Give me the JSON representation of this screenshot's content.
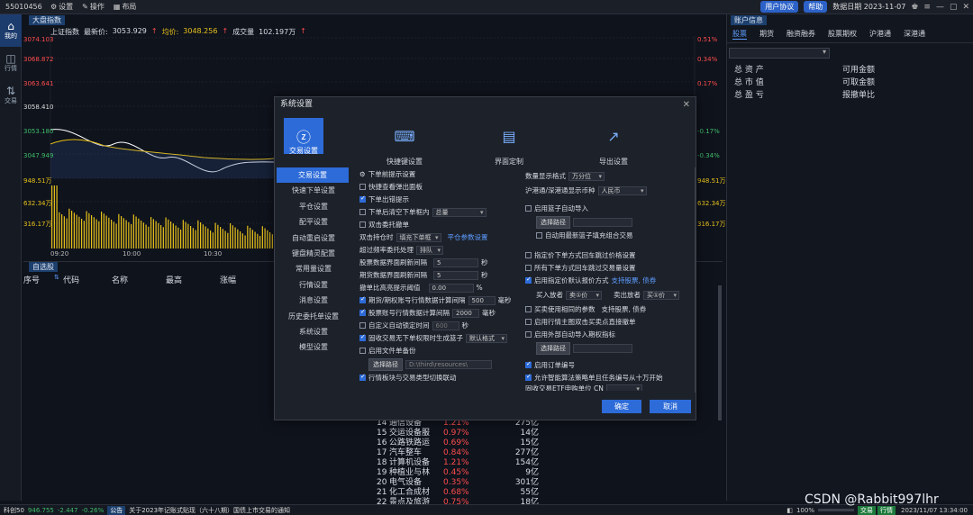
{
  "topbar": {
    "account": "55010456",
    "items": [
      {
        "label": "设置",
        "icon": "gear-icon"
      },
      {
        "label": "操作",
        "icon": "edit-icon"
      },
      {
        "label": "布局",
        "icon": "layout-icon"
      }
    ],
    "user_agreement": "用户协议",
    "help": "帮助",
    "data_date": "数据日期 2023-11-07"
  },
  "leftnav": [
    {
      "label": "我的",
      "icon": "home-icon",
      "active": true
    },
    {
      "label": "行情",
      "icon": "chart-icon",
      "active": false
    },
    {
      "label": "交易",
      "icon": "trade-icon",
      "active": false
    }
  ],
  "chart": {
    "tab": "大盘指数",
    "header": {
      "index_name": "上证指数",
      "latest_label": "最新价:",
      "latest_value": "3053.929",
      "avg_label": "均价:",
      "avg_value": "3048.256",
      "vol_label": "成交量",
      "vol_value": "102.197万"
    },
    "y_left": [
      "3074.103",
      "3068.872",
      "3063.641",
      "3058.410",
      "3053.180",
      "3047.949",
      "948.51万",
      "632.34万",
      "316.17万"
    ],
    "y_right": [
      "0.51%",
      "0.34%",
      "0.17%",
      "",
      "-0.17%",
      "-0.34%",
      "948.51万",
      "632.34万",
      "316.17万"
    ],
    "x_labels": [
      "09:20",
      "10:00",
      "10:30"
    ]
  },
  "zone": {
    "tab": "自选股",
    "headers": [
      "序号",
      "代码",
      "名称",
      "最高",
      "涨幅"
    ]
  },
  "sectors": [
    {
      "no": "14",
      "name": "通信设备",
      "pct": "1.21%",
      "amt": "275亿"
    },
    {
      "no": "15",
      "name": "交运设备服",
      "pct": "0.97%",
      "amt": "14亿"
    },
    {
      "no": "16",
      "name": "公路铁路运",
      "pct": "0.69%",
      "amt": "15亿"
    },
    {
      "no": "17",
      "name": "汽车整车",
      "pct": "0.84%",
      "amt": "277亿"
    },
    {
      "no": "18",
      "name": "计算机设备",
      "pct": "1.21%",
      "amt": "154亿"
    },
    {
      "no": "19",
      "name": "种植业与林",
      "pct": "0.45%",
      "amt": "9亿"
    },
    {
      "no": "20",
      "name": "电气设备",
      "pct": "0.35%",
      "amt": "301亿"
    },
    {
      "no": "21",
      "name": "化工合成材",
      "pct": "0.68%",
      "amt": "55亿"
    },
    {
      "no": "22",
      "name": "景点及旅游",
      "pct": "0.75%",
      "amt": "18亿"
    }
  ],
  "right_panel": {
    "title": "账户信息",
    "tabs": [
      "股票",
      "期货",
      "融资融券",
      "股票期权",
      "沪港通",
      "深港通"
    ],
    "rows": [
      [
        "总 资 产",
        "可用金额"
      ],
      [
        "总 市 值",
        "可取金额"
      ],
      [
        "总 盈 亏",
        "报撤单比"
      ]
    ]
  },
  "dialog": {
    "title": "系统设置",
    "tabs": [
      {
        "label": "交易设置",
        "icon": "trade-settings-icon"
      },
      {
        "label": "快捷键设置",
        "icon": "keyboard-icon"
      },
      {
        "label": "界面定制",
        "icon": "layout-custom-icon"
      },
      {
        "label": "导出设置",
        "icon": "export-icon"
      }
    ],
    "sidebar": [
      "交易设置",
      "快速下单设置",
      "平仓设置",
      "配平设置",
      "自动重启设置",
      "键盘精灵配置",
      "常用量设置",
      "行情设置",
      "消息设置",
      "历史委托单设置",
      "系统设置",
      "模型设置"
    ],
    "left": {
      "section": "下单前提示设置",
      "items": [
        {
          "label": "快捷查看弹出面板",
          "checked": false
        },
        {
          "label": "下单出错提示",
          "checked": true
        },
        {
          "label": "下单后清空下单框内",
          "checked": false,
          "select": "总量"
        },
        {
          "label": "双击委托撤单",
          "checked": false
        }
      ],
      "double_click_label": "双击持仓时",
      "double_click_select": "填充下单框",
      "pos_link": "平仓参数设置",
      "over_freq_label": "超过频率委托处理",
      "over_freq_select": "排队",
      "stock_refresh_label": "股票数据界面刷新间隔",
      "stock_refresh_value": "5",
      "futures_refresh_label": "期货数据界面刷新间隔",
      "futures_refresh_value": "5",
      "ratio_label": "撤单比高亮提示阈值",
      "ratio_value": "0.00",
      "sec_unit": "秒",
      "pct_unit": "%",
      "ms_unit": "毫秒",
      "futures_quote_label": "期货/期权账号行情数据计算间隔",
      "futures_quote_value": "500",
      "stock_quote_label": "股票账号行情数据计算间隔",
      "stock_quote_value": "2000",
      "auto_lock_label": "自定义自动锁定时间",
      "auto_lock_value": "600",
      "fund_label": "固收交易无下单权限时生成篮子",
      "fund_select": "默认格式",
      "file_backup_label": "启用文件单备份",
      "path_btn": "选择路径",
      "path_value": "D:\\third\\resources\\",
      "link_label": "行情板块与交易类型切换联动"
    },
    "right": {
      "qty_format_label": "数量显示格式",
      "qty_format_select": "万分位",
      "hk_currency_label": "沪港通/深港通显示币种",
      "hk_currency_select": "人民币",
      "basket_import": "启用篮子自动导入",
      "path_btn": "选择路径",
      "auto_fill": "自动用最新篮子填充组合交易",
      "specify_default": "指定价下单方式回车跳过价格设置",
      "all_default": "所有下单方式回车跳过交易量设置",
      "enable_price": "启用指定价默认报价方式",
      "support_note": "支持股票, 债券",
      "buy_label": "买入放者",
      "buy_select": "卖①价",
      "sell_label": "卖出放者",
      "sell_select": "买①价",
      "same_price": "买卖使用相同的参数",
      "same_note": "支持股票, 债券",
      "dbl_click_quote": "启用行情主图双击买卖点直接撤单",
      "external_basket": "启用外部自动导入期权指标",
      "enable_number": "启用订单编号",
      "allow_algo": "允许智能算法策略单且任务编号从十万开始",
      "fixed_etf": "固收交易ETF申购单位 CN"
    },
    "ok": "确定",
    "cancel": "取消"
  },
  "bottombar": {
    "index_label": "科创50",
    "index_value": "946.755",
    "index_chg": "-2.447",
    "index_pct": "-0.26%",
    "notice_tag": "公告",
    "notice": "关于2023年记账式贴现（六十八期）国债上市交易的通知",
    "zoom": "100%",
    "trade_tag": "交易",
    "quote_tag": "行情",
    "datetime": "2023/11/07 13:34:00"
  },
  "watermark": "CSDN @Rabbit997lhr"
}
